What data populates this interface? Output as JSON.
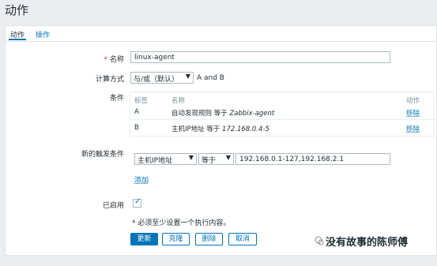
{
  "page_title": "动作",
  "tabs": [
    {
      "label": "动作"
    },
    {
      "label": "操作"
    }
  ],
  "form": {
    "name_label": "名称",
    "name_value": "linux-agent",
    "calc_label": "计算方式",
    "calc_value": "与/或（默认）",
    "calc_expr": "A and B",
    "conditions_label": "条件",
    "conditions": {
      "headers": {
        "label": "标签",
        "name": "名称",
        "action": "动作"
      },
      "rows": [
        {
          "label": "A",
          "prefix": "自动发现规则 等于 ",
          "value": "Zabbix-agent",
          "action": "移除"
        },
        {
          "label": "B",
          "prefix": "主机IP地址 等于 ",
          "value": "172.168.0.4-5",
          "action": "移除"
        }
      ]
    },
    "new_condition_label": "新的触发条件",
    "new_condition_type": "主机IP地址",
    "new_condition_operator": "等于",
    "new_condition_value": "192.168.0.1-127,192.168.2.1",
    "add_link": "添加",
    "enabled_label": "已启用",
    "enabled": true,
    "note": "* 必须至少设置一个执行内容。"
  },
  "buttons": {
    "update": "更新",
    "clone": "克隆",
    "delete": "删除",
    "cancel": "取消"
  },
  "watermark": "没有故事的陈师傅",
  "colors": {
    "accent": "#0275b8",
    "required": "#e33734",
    "background": "#ebeef0"
  }
}
